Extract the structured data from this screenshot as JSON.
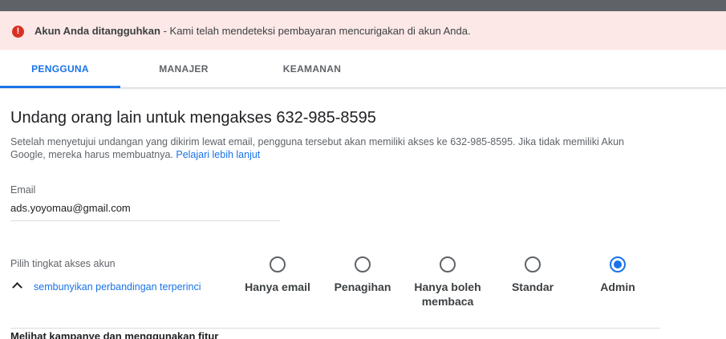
{
  "alert": {
    "icon": "error-icon",
    "title": "Akun Anda ditangguhkan",
    "separator": " - ",
    "message": "Kami telah mendeteksi pembayaran mencurigakan di akun Anda.",
    "color": "#d93025"
  },
  "tabs": [
    {
      "label": "PENGGUNA",
      "active": true
    },
    {
      "label": "MANAJER",
      "active": false
    },
    {
      "label": "KEAMANAN",
      "active": false
    }
  ],
  "main": {
    "title": "Undang orang lain untuk mengakses 632-985-8595",
    "description": "Setelah menyetujui undangan yang dikirim lewat email, pengguna tersebut akan memiliki akses ke 632-985-8595. Jika tidak memiliki Akun Google, mereka harus membuatnya. ",
    "learn_more": "Pelajari lebih lanjut"
  },
  "email": {
    "label": "Email",
    "value": "ads.yoyomau@gmail.com"
  },
  "access": {
    "label": "Pilih tingkat akses akun",
    "toggle_text": "sembunyikan perbandingan terperinci",
    "toggle_icon": "chevron-up-icon",
    "options": [
      {
        "label": "Hanya email",
        "checked": false
      },
      {
        "label": "Penagihan",
        "checked": false
      },
      {
        "label": "Hanya boleh membaca",
        "checked": false
      },
      {
        "label": "Standar",
        "checked": false
      },
      {
        "label": "Admin",
        "checked": true
      }
    ]
  },
  "section": {
    "heading": "Melihat kampanye dan menggunakan fitur"
  },
  "colors": {
    "accent": "#1a73e8",
    "alert_bg": "#fce8e6",
    "topbar": "#5f6368"
  }
}
